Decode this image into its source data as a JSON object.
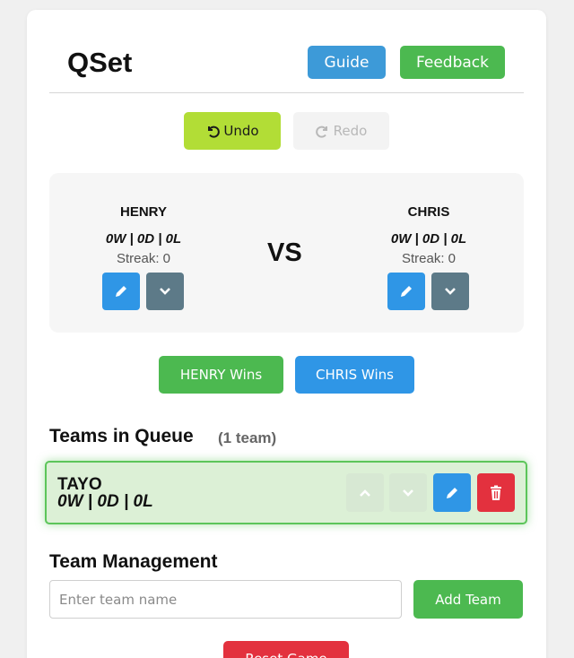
{
  "app": {
    "title": "QSet"
  },
  "header": {
    "guide_label": "Guide",
    "feedback_label": "Feedback"
  },
  "history": {
    "undo_label": "Undo",
    "redo_label": "Redo"
  },
  "match": {
    "vs_label": "VS",
    "left": {
      "name": "HENRY",
      "record": "0W | 0D | 0L",
      "streak": "Streak: 0"
    },
    "right": {
      "name": "CHRIS",
      "record": "0W | 0D | 0L",
      "streak": "Streak: 0"
    },
    "left_win_label": "HENRY Wins",
    "right_win_label": "CHRIS Wins"
  },
  "queue": {
    "heading": "Teams in Queue",
    "count": "(1 team)",
    "items": [
      {
        "name": "TAYO",
        "record": "0W | 0D | 0L"
      }
    ]
  },
  "management": {
    "heading": "Team Management",
    "input_placeholder": "Enter team name",
    "input_value": "",
    "add_label": "Add Team",
    "reset_label": "Reset Game"
  },
  "colors": {
    "green": "#4cb950",
    "blue": "#2f96e6",
    "lime": "#b2dd36",
    "slate": "#5d7a88",
    "red": "#e3313e"
  },
  "icons": [
    "undo-icon",
    "redo-icon",
    "pencil-icon",
    "chevron-down-icon",
    "chevron-up-icon",
    "trash-icon"
  ]
}
